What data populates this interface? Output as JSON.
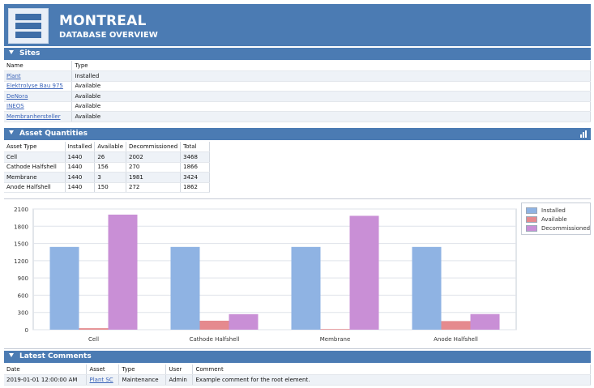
{
  "header": {
    "title": "MONTREAL",
    "subtitle": "DATABASE OVERVIEW",
    "logo_icon": "database-list-icon"
  },
  "sites": {
    "title": "Sites",
    "columns": [
      "Name",
      "Type"
    ],
    "rows": [
      {
        "name": "Plant",
        "type": "Installed"
      },
      {
        "name": "Elektrolyse Bau 975",
        "type": "Available"
      },
      {
        "name": "DeNora",
        "type": "Available"
      },
      {
        "name": "INEOS",
        "type": "Available"
      },
      {
        "name": "Membranhersteller",
        "type": "Available"
      }
    ]
  },
  "assets": {
    "title": "Asset Quantities",
    "chart_toggle_icon": "bar-chart-icon",
    "columns": [
      "Asset Type",
      "Installed",
      "Available",
      "Decommissioned",
      "Total"
    ],
    "rows": [
      [
        "Cell",
        "1440",
        "26",
        "2002",
        "3468"
      ],
      [
        "Cathode Halfshell",
        "1440",
        "156",
        "270",
        "1866"
      ],
      [
        "Membrane",
        "1440",
        "3",
        "1981",
        "3424"
      ],
      [
        "Anode Halfshell",
        "1440",
        "150",
        "272",
        "1862"
      ]
    ]
  },
  "chart_data": {
    "type": "bar",
    "categories": [
      "Cell",
      "Cathode Halfshell",
      "Membrane",
      "Anode Halfshell"
    ],
    "series": [
      {
        "name": "Installed",
        "values": [
          1440,
          1440,
          1440,
          1440
        ],
        "color": "#8fb3e3"
      },
      {
        "name": "Available",
        "values": [
          26,
          156,
          3,
          150
        ],
        "color": "#e58a8e"
      },
      {
        "name": "Decommissioned",
        "values": [
          2002,
          270,
          1981,
          272
        ],
        "color": "#c98fd6"
      }
    ],
    "ylim": [
      0,
      2100
    ],
    "yticks": [
      0,
      300,
      600,
      900,
      1200,
      1500,
      1800,
      2100
    ],
    "grid": true,
    "legend": "top-right"
  },
  "comments": {
    "title": "Latest Comments",
    "columns": [
      "Date",
      "Asset",
      "Type",
      "User",
      "Comment"
    ],
    "rows": [
      {
        "date": "2019-01-01 12:00:00 AM",
        "asset": "Plant SC",
        "type": "Maintenance",
        "user": "Admin",
        "comment": "Example comment for the root element."
      }
    ]
  },
  "colors": {
    "header_blue": "#4b7bb3",
    "link_blue": "#3a63b8"
  }
}
